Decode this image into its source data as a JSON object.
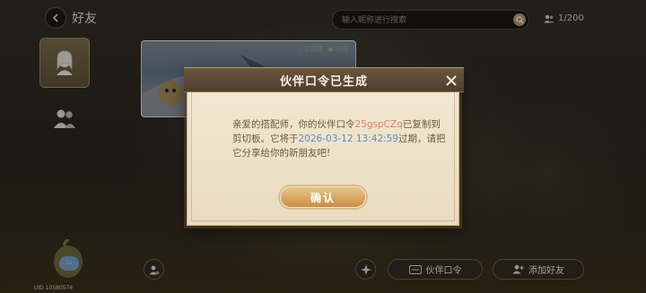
{
  "header": {
    "back_icon": "back-arrow-icon",
    "title": "好友",
    "search_placeholder": "输入昵称进行搜索",
    "friend_count": "1/200"
  },
  "friend_card": {
    "status_left": "◇ 花语镇",
    "status_right": "● 在线"
  },
  "bottom_bar": {
    "partner_code_label": "伙伴口令",
    "add_friend_label": "添加好友",
    "uid_text": "UID 10580574"
  },
  "modal": {
    "title": "伙伴口令已生成",
    "text_part1": "亲爱的搭配师，你的伙伴口令",
    "code": "25gspCZq",
    "text_part2": "已复制到剪切板。它将于",
    "expiry": "2026-03-12 13:42:59",
    "text_part3": "过期，请把它分享给你的新朋友吧!",
    "confirm_label": "确认"
  },
  "colors": {
    "code_highlight": "#e37c6a",
    "date_highlight": "#5a8ec2",
    "confirm_button": "#d6a55f",
    "modal_bg": "#f1e6cf",
    "header_bar": "#5a4934"
  }
}
